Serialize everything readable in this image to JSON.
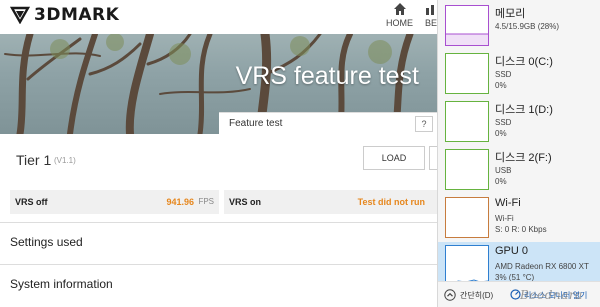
{
  "app": {
    "logo_text": "3DMARK",
    "nav": {
      "home_label": "HOME",
      "second_label": "BE"
    }
  },
  "hero": {
    "title": "VRS feature test"
  },
  "test_tab": {
    "label": "Feature test",
    "help_label": "?"
  },
  "tier": {
    "title": "Tier 1",
    "version": "(V1.1)",
    "load_label": "LOAD"
  },
  "results": {
    "off": {
      "label": "VRS off",
      "value": "941.96",
      "unit": "FPS"
    },
    "on": {
      "label": "VRS on",
      "value": "Test did not run"
    }
  },
  "sections": [
    {
      "title": "Settings used"
    },
    {
      "title": "System information"
    }
  ],
  "task_manager": {
    "items": [
      {
        "name": "메모리",
        "line1": "4.5/15.9GB (28%)",
        "line2": "",
        "color": "#a84fd0",
        "selected": false
      },
      {
        "name": "디스크 0(C:)",
        "line1": "SSD",
        "line2": "0%",
        "color": "#66b33f",
        "selected": false
      },
      {
        "name": "디스크 1(D:)",
        "line1": "SSD",
        "line2": "0%",
        "color": "#66b33f",
        "selected": false
      },
      {
        "name": "디스크 2(F:)",
        "line1": "USB",
        "line2": "0%",
        "color": "#66b33f",
        "selected": false
      },
      {
        "name": "Wi-Fi",
        "line1": "Wi-Fi",
        "line2": "S: 0 R: 0 Kbps",
        "color": "#c77c3e",
        "selected": false
      },
      {
        "name": "GPU 0",
        "line1": "AMD Radeon RX 6800 XT",
        "line2": "3% (51 °C)",
        "color": "#2f7fd0",
        "selected": true
      }
    ],
    "footer": {
      "collapse_label": "간단히(D)",
      "monitor_label": "리소스 모니터 열기"
    }
  },
  "watermark": {
    "text": "Boodnara"
  },
  "colors": {
    "accent_orange": "#e6871e",
    "selected_bg": "#cce4f7"
  }
}
